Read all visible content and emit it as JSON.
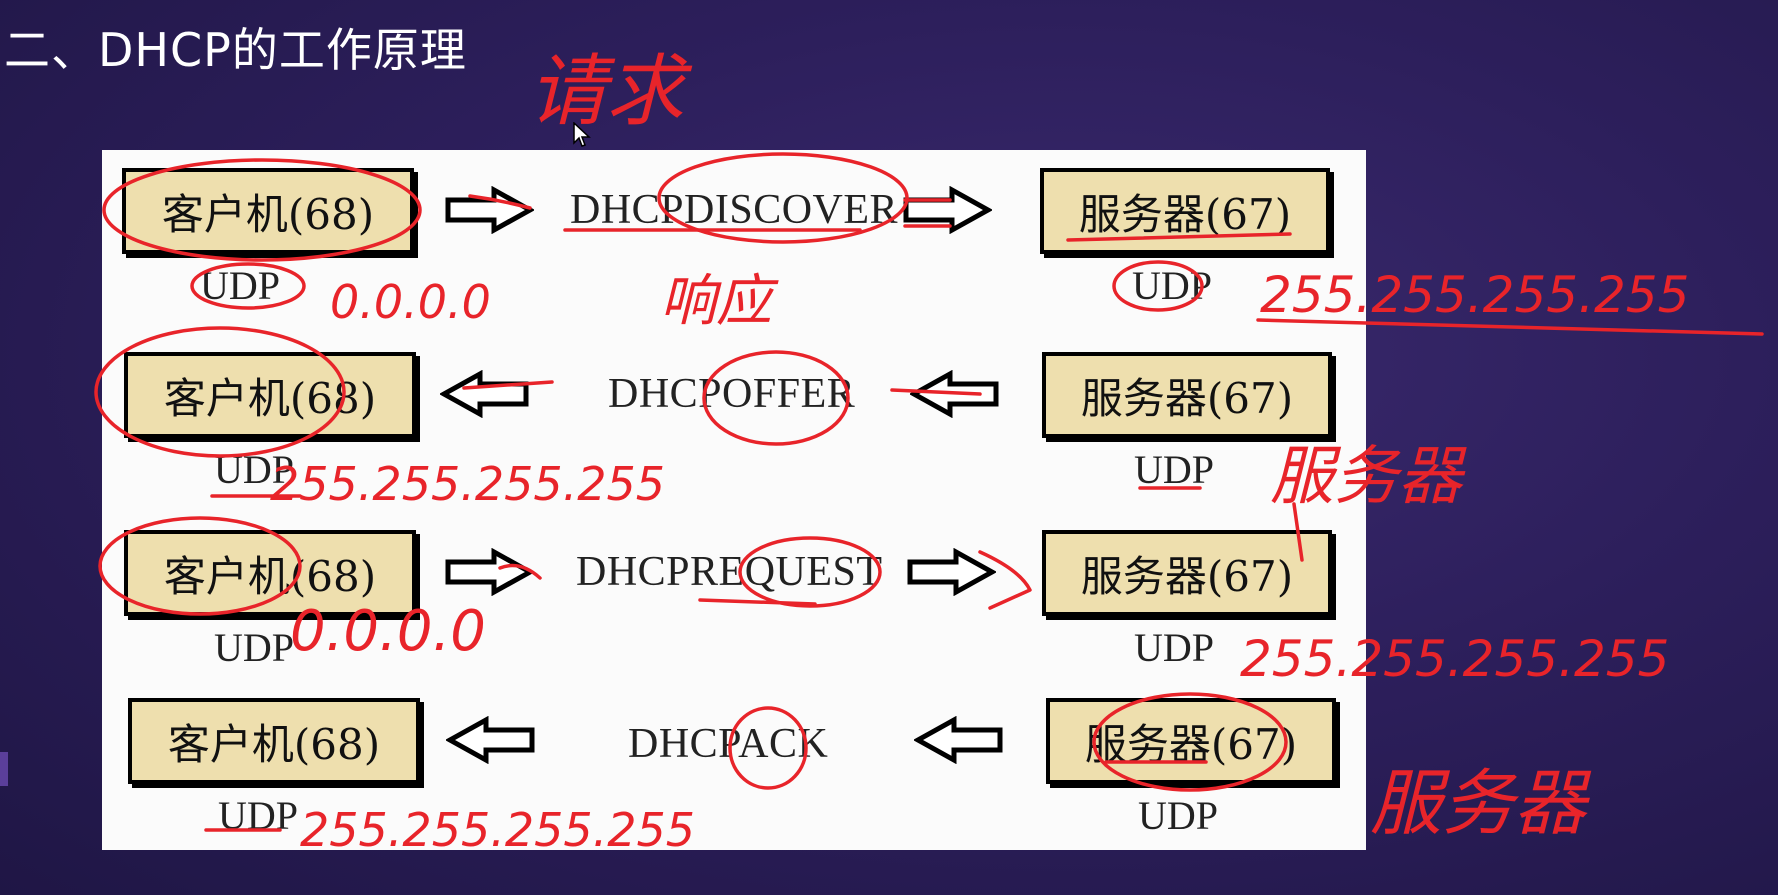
{
  "slide": {
    "title": "二、DHCP的工作原理"
  },
  "rows": [
    {
      "client": "客户机(68)",
      "server": "服务器(67)",
      "message": "DHCPDISCOVER",
      "client_port": "UDP",
      "server_port": "UDP",
      "direction": "right"
    },
    {
      "client": "客户机(68)",
      "server": "服务器(67)",
      "message": "DHCPOFFER",
      "client_port": "UDP",
      "server_port": "UDP",
      "direction": "left"
    },
    {
      "client": "客户机(68)",
      "server": "服务器(67)",
      "message": "DHCPREQUEST",
      "client_port": "UDP",
      "server_port": "UDP",
      "direction": "right"
    },
    {
      "client": "客户机(68)",
      "server": "服务器(67)",
      "message": "DHCPACK",
      "client_port": "UDP",
      "server_port": "UDP",
      "direction": "left"
    }
  ],
  "annotations": {
    "top_word": "请求",
    "row1_client_addr": "0.0.0.0",
    "row1_response": "响应",
    "row1_server_addr": "255.255.255.255",
    "row2_client_addr": "255.255.255.255",
    "row2_server_note": "服务器",
    "row3_client_addr": "0.0.0.0",
    "row3_server_addr": "255.255.255.255",
    "row4_client_addr": "255.255.255.255",
    "row4_server_note": "服务器"
  },
  "colors": {
    "ink": "#e8242a",
    "box_fill": "#eedfae",
    "background": "#2d1f5c"
  }
}
